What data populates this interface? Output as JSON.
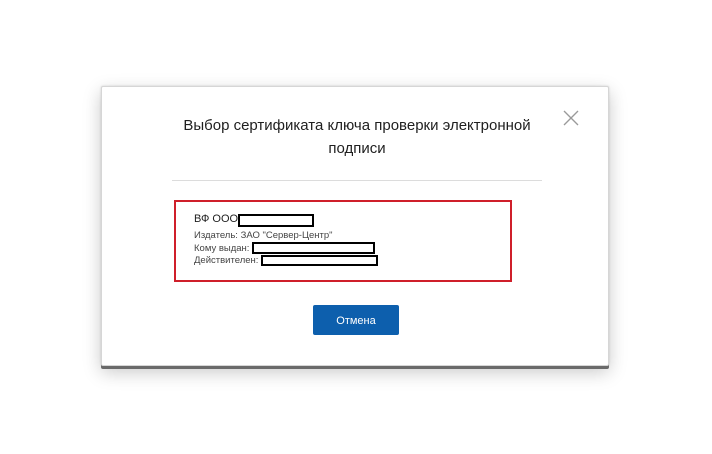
{
  "dialog": {
    "title": "Выбор сертификата ключа проверки электронной подписи",
    "close_icon": "close-icon",
    "certificate": {
      "name": "ВФ ООО \"",
      "issuer_label": "Издатель:",
      "issuer_value": "ЗАО \"Сервер-Центр\"",
      "owner_label": "Кому выдан:",
      "valid_label": "Действителен:"
    },
    "cancel_label": "Отмена"
  },
  "colors": {
    "highlight_border": "#cf1f2a",
    "primary_button": "#0d5fad"
  }
}
